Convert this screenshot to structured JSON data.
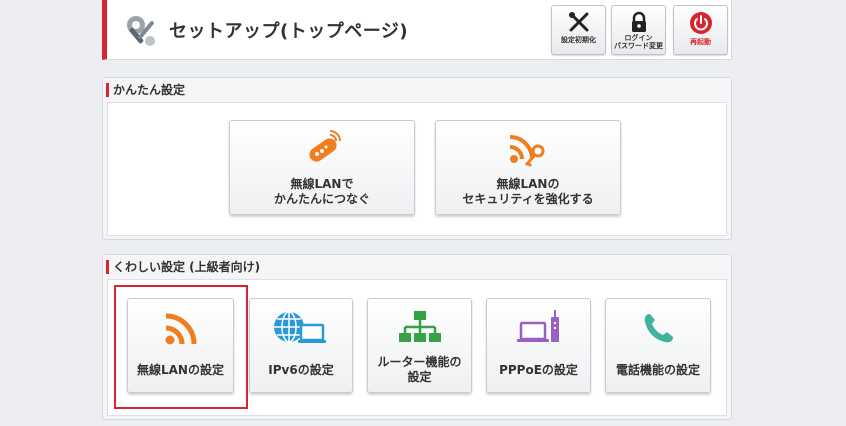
{
  "header": {
    "title": "セットアップ(トップページ)",
    "buttons": {
      "reset_label": "設定初期化",
      "login_label": "ログイン\nパスワード変更",
      "reboot_label": "再起動"
    }
  },
  "easy_section": {
    "title": "かんたん設定",
    "tiles": [
      {
        "label": "無線LANで\nかんたんにつなぐ",
        "icon": "remote-controller-icon"
      },
      {
        "label": "無線LANの\nセキュリティを強化する",
        "icon": "wifi-key-icon"
      }
    ]
  },
  "detail_section": {
    "title": "くわしい設定 (上級者向け)",
    "tiles": [
      {
        "label": "無線LANの設定",
        "icon": "wifi-icon"
      },
      {
        "label": "IPv6の設定",
        "icon": "globe-laptop-icon"
      },
      {
        "label": "ルーター機能の\n設定",
        "icon": "network-tree-icon"
      },
      {
        "label": "PPPoEの設定",
        "icon": "laptop-router-icon"
      },
      {
        "label": "電話機能の設定",
        "icon": "phone-icon"
      }
    ]
  },
  "colors": {
    "accent_red": "#d9232e",
    "orange": "#f07e1f",
    "blue": "#2a9ad6",
    "green": "#37a146",
    "purple": "#9a5fc2",
    "teal": "#3fb39b"
  }
}
